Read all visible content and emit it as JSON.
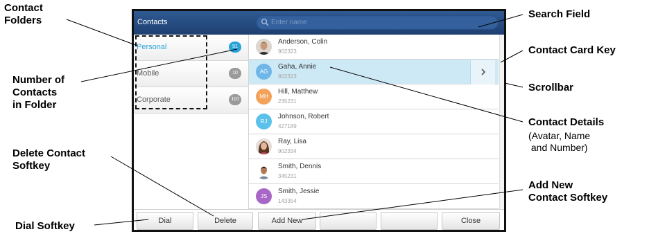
{
  "screen": {
    "app_title": "Contacts",
    "search": {
      "placeholder": "Enter name",
      "icon": "search-icon"
    },
    "folders": [
      {
        "label": "Personal",
        "count": "51",
        "active": true
      },
      {
        "label": "Mobile",
        "count": "10",
        "active": false
      },
      {
        "label": "Corporate",
        "count": "110",
        "active": false
      }
    ],
    "contacts": [
      {
        "name": "Anderson, Colin",
        "number": "902323",
        "avatar": "photo"
      },
      {
        "name": "Gaha, Annie",
        "number": "902323",
        "avatar": "AG",
        "avatar_color": "#6fb7e8",
        "selected": true
      },
      {
        "name": "Hill, Matthew",
        "number": "235231",
        "avatar": "MH",
        "avatar_color": "#f4a25a"
      },
      {
        "name": "Johnson, Robert",
        "number": "427189",
        "avatar": "RJ",
        "avatar_color": "#5bc0ea"
      },
      {
        "name": "Ray, Lisa",
        "number": "902334",
        "avatar": "photo"
      },
      {
        "name": "Smith, Dennis",
        "number": "345231",
        "avatar": "photo"
      },
      {
        "name": "Smith, Jessie",
        "number": "143354",
        "avatar": "JS",
        "avatar_color": "#a867c7"
      }
    ],
    "card_key_icon": "chevron-right-icon",
    "softkeys": [
      "Dial",
      "Delete",
      "Add New",
      "",
      "",
      "Close"
    ]
  },
  "callouts": {
    "contact_folders": [
      "Contact",
      "Folders"
    ],
    "number_of_contacts": [
      "Number of",
      "Contacts",
      "in Folder"
    ],
    "delete_softkey": [
      "Delete Contact",
      "Softkey"
    ],
    "dial_softkey": "Dial Softkey",
    "search_field": "Search Field",
    "contact_card_key": "Contact Card Key",
    "scrollbar": "Scrollbar",
    "contact_details": "Contact Details",
    "contact_details_sub": [
      "(Avatar, Name",
      " and Number)"
    ],
    "add_new_softkey": [
      "Add New",
      "Contact Softkey"
    ]
  },
  "colors": {
    "header": "#1e3f70",
    "accent": "#27a3d8",
    "selected_row": "#cde9f5"
  }
}
